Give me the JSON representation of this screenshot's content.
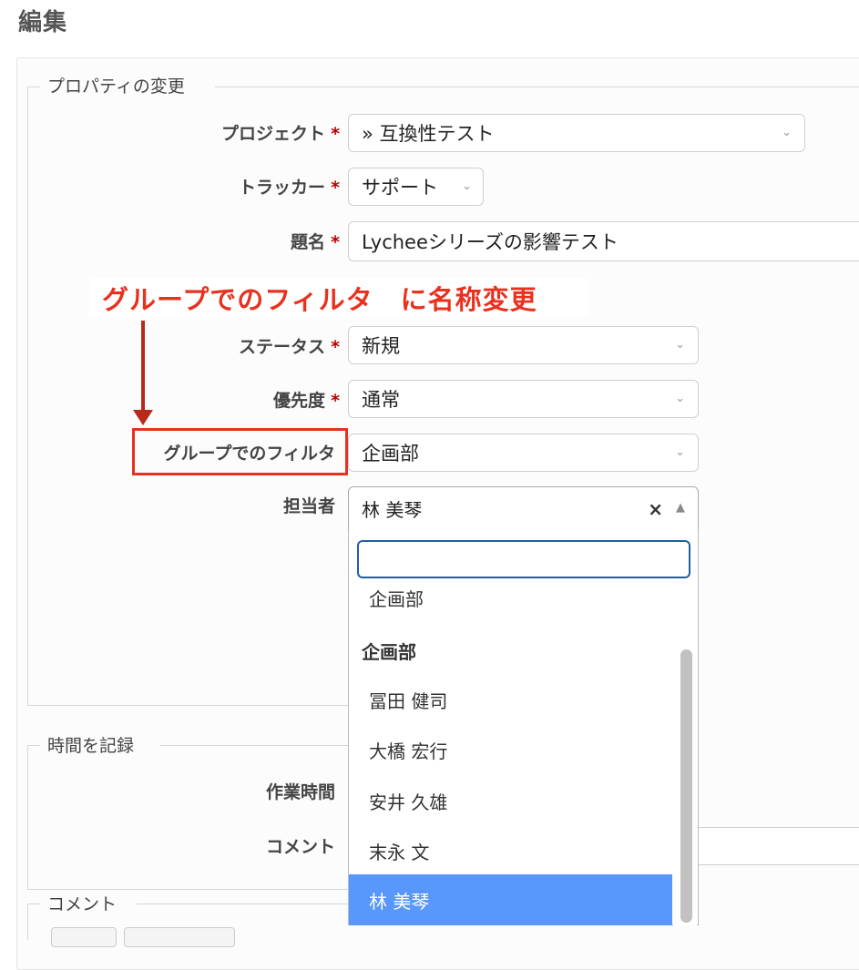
{
  "page": {
    "title": "編集"
  },
  "properties": {
    "legend": "プロパティの変更",
    "project": {
      "label": "プロジェクト",
      "value": "» 互換性テスト"
    },
    "tracker": {
      "label": "トラッカー",
      "value": "サポート"
    },
    "subject": {
      "label": "題名",
      "value": "Lycheeシリーズの影響テスト"
    },
    "status": {
      "label": "ステータス",
      "value": "新規"
    },
    "priority": {
      "label": "優先度",
      "value": "通常"
    },
    "group_filter": {
      "label": "グループでのフィルタ",
      "value": "企画部"
    },
    "assignee": {
      "label": "担当者",
      "value": "林 美琴",
      "clear": "×",
      "toggle": "▲"
    }
  },
  "required_mark": "*",
  "annotation": "グループでのフィルタ　に名称変更",
  "dropdown": {
    "search_value": "",
    "partial_option": "企画部",
    "group_label": "企画部",
    "options": [
      "冨田 健司",
      "大橋 宏行",
      "安井 久雄",
      "末永 文",
      "林 美琴"
    ],
    "selected": "林 美琴"
  },
  "time_entry": {
    "legend": "時間を記録",
    "hours_label": "作業時間",
    "comment_label": "コメント"
  },
  "notes": {
    "legend": "コメント"
  },
  "colors": {
    "annotation": "#e8311f",
    "selected": "#5897fb",
    "required": "#bb0000"
  }
}
